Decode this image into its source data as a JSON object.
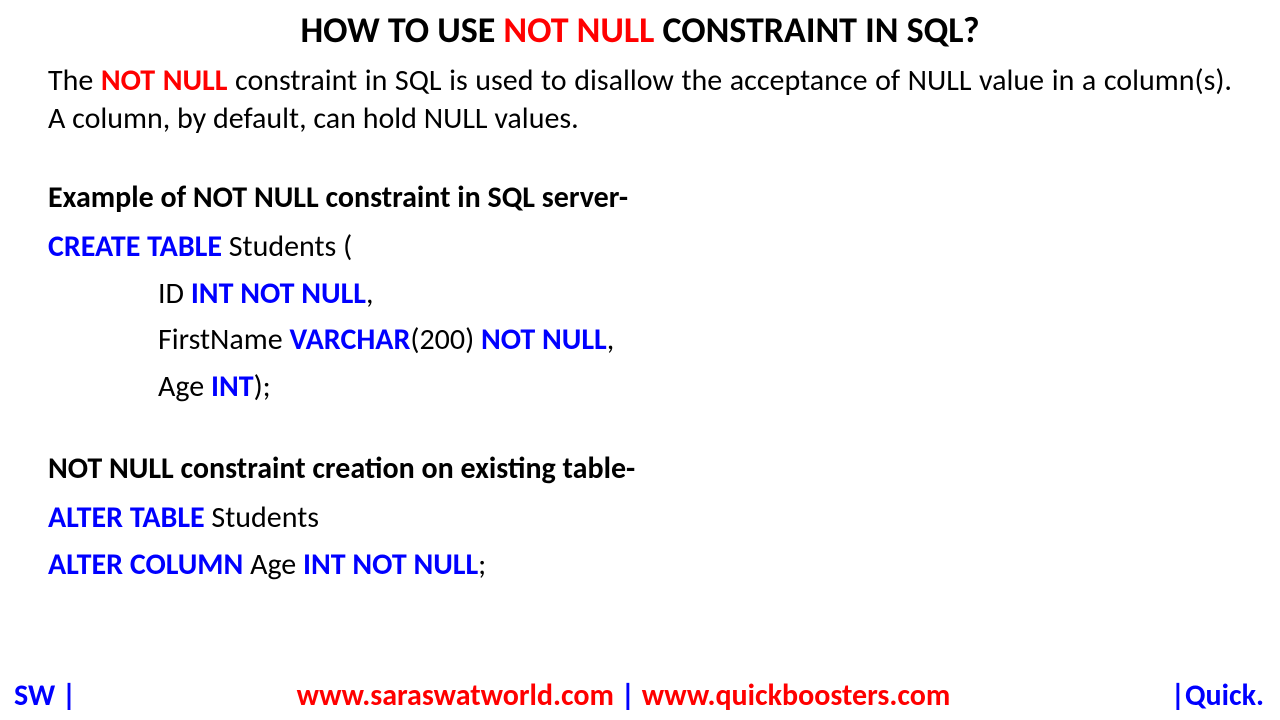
{
  "title": {
    "pre": "HOW TO USE ",
    "highlight": "NOT NULL",
    "post": " CONSTRAINT IN SQL?"
  },
  "intro": {
    "t1": "The ",
    "highlight": "NOT NULL",
    "t2": " constraint in SQL is used to disallow the acceptance of NULL value in a column(s). A column, by default, can hold NULL values."
  },
  "section1": {
    "heading": "Example of NOT NULL constraint in SQL server-",
    "line1": {
      "kw": "CREATE TABLE",
      "rest": " Students ("
    },
    "line2": {
      "pre": "ID ",
      "kw": "INT NOT NULL",
      "post": ","
    },
    "line3": {
      "pre": "FirstName ",
      "kw1": "VARCHAR",
      "mid": "(200) ",
      "kw2": "NOT NULL",
      "post": ","
    },
    "line4": {
      "pre": "Age ",
      "kw": "INT",
      "post": ");"
    }
  },
  "section2": {
    "heading": "NOT NULL constraint creation on existing table-",
    "line1": {
      "kw": "ALTER TABLE",
      "rest": " Students"
    },
    "line2": {
      "kw1": "ALTER COLUMN",
      "mid": " Age ",
      "kw2": "INT NOT NULL",
      "post": ";"
    }
  },
  "footer": {
    "left": "SW |",
    "mid_url1": "www.saraswatworld.com",
    "mid_sep": " | ",
    "mid_url2": "www.quickboosters.com",
    "right": "|Quick."
  }
}
